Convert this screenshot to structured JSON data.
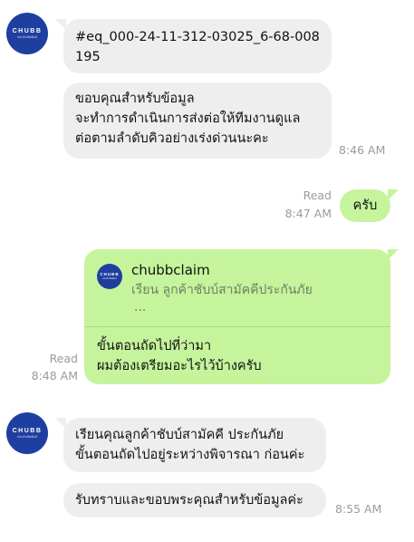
{
  "colors": {
    "bubble_in": "#eeeeee",
    "bubble_out": "#c5f49c",
    "avatar_bg": "#1f3fa0",
    "meta_text": "#9a9a9a"
  },
  "avatar": {
    "brand": "CHUBB",
    "subtitle": "ประกันภัยชับบ์",
    "icon": "chubb-logo-icon"
  },
  "messages": [
    {
      "id": "m1",
      "side": "incoming",
      "lines": [
        "#eq_000-24-11-312-03025_6-68-008",
        "195"
      ]
    },
    {
      "id": "m2",
      "side": "incoming",
      "lines": [
        "ขอบคุณสำหรับข้อมูล",
        "จะทำการดำเนินการส่งต่อให้ทีมงานดูแล",
        "ต่อตามลำดับคิวอย่างเร่งด่วนนะคะ"
      ],
      "time": "8:46 AM"
    },
    {
      "id": "m3",
      "side": "outgoing",
      "text": "ครับ",
      "read": "Read",
      "time": "8:47 AM"
    },
    {
      "id": "m4",
      "side": "outgoing",
      "quote": {
        "name": "chubbclaim",
        "text": "เรียน ลูกค้าชับบ์สามัคคีประกันภัย",
        "more": "..."
      },
      "lines": [
        "ขั้นตอนถัดไปที่ว่ามา",
        "ผมต้องเตรียมอะไรไว้บ้างครับ"
      ],
      "read": "Read",
      "time": "8:48 AM"
    },
    {
      "id": "m5",
      "side": "incoming",
      "lines": [
        "เรียนคุณลูกค้าชับบ์สามัคคี ประกันภัย",
        "ขั้นตอนถัดไปอยู่ระหว่างพิจารณา ก่อนค่ะ"
      ]
    },
    {
      "id": "m6",
      "side": "incoming",
      "lines": [
        "รับทราบและขอบพระคุณสำหรับข้อมูลค่ะ"
      ],
      "time": "8:55 AM"
    }
  ]
}
